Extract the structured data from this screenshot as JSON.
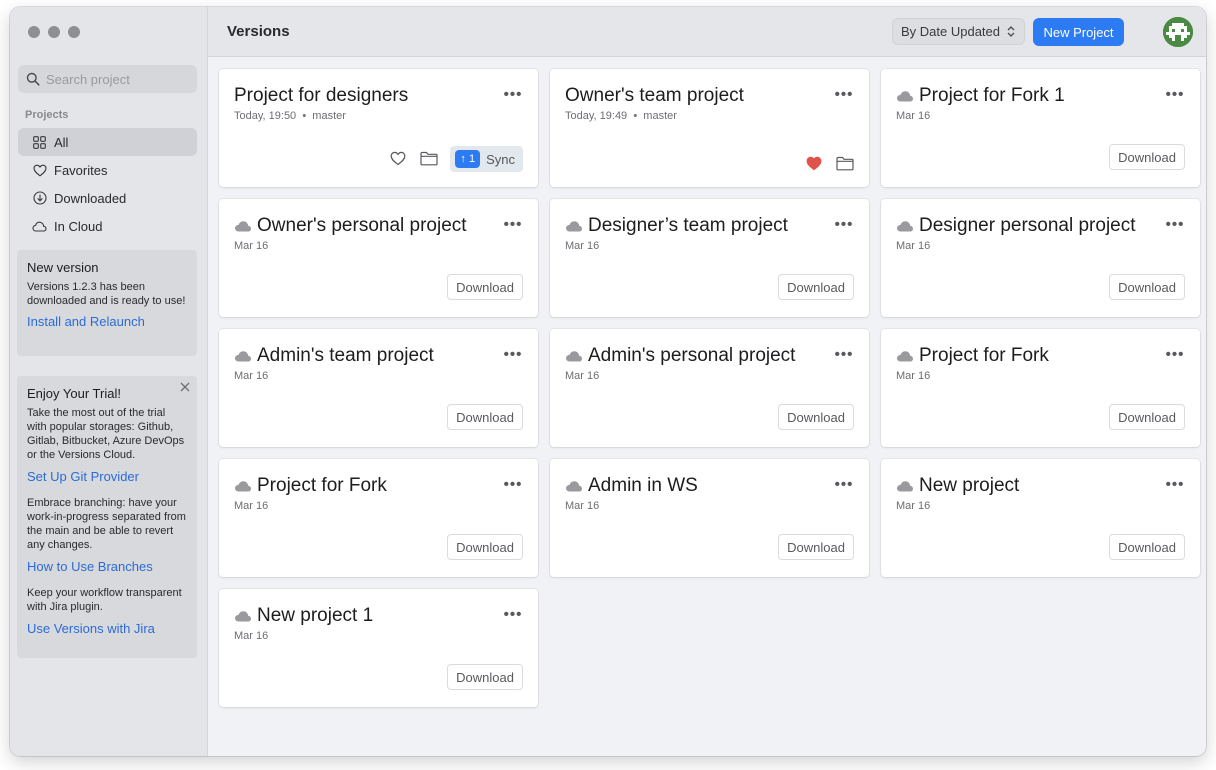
{
  "app": {
    "title": "Versions"
  },
  "sidebar": {
    "search_placeholder": "Search project",
    "section_label": "Projects",
    "items": [
      {
        "label": "All",
        "icon": "grid-icon",
        "active": true
      },
      {
        "label": "Favorites",
        "icon": "heart-icon"
      },
      {
        "label": "Downloaded",
        "icon": "download-circle-icon"
      },
      {
        "label": "In Cloud",
        "icon": "cloud-icon"
      }
    ],
    "update": {
      "title": "New version",
      "text": "Versions 1.2.3 has been downloaded and is ready to use!",
      "link": "Install and Relaunch"
    },
    "trial": {
      "title": "Enjoy Your Trial!",
      "tips": [
        {
          "text": "Take the most out of the trial with popular storages: Github, Gitlab, Bitbucket, Azure DevOps or the Versions Cloud.",
          "link": "Set Up Git Provider"
        },
        {
          "text": "Embrace branching: have your work-in-progress separated from the main and be able to revert any changes.",
          "link": "How to Use Branches"
        },
        {
          "text": "Keep your workflow transparent with Jira plugin.",
          "link": "Use Versions with Jira"
        }
      ]
    }
  },
  "toolbar": {
    "sort_label": "By Date Updated",
    "new_project_label": "New Project"
  },
  "projects": [
    {
      "name": "Project for designers",
      "date": "Today, 19:50",
      "separator": "•",
      "branch": "master",
      "local": true,
      "favorite": false,
      "sync_count": "↑ 1",
      "sync_label": "Sync"
    },
    {
      "name": "Owner's team project",
      "date": "Today, 19:49",
      "separator": "•",
      "branch": "master",
      "local": true,
      "favorite": true
    },
    {
      "name": "Project for Fork 1",
      "date": "Mar 16",
      "download_label": "Download"
    },
    {
      "name": "Owner's personal project",
      "date": "Mar 16",
      "download_label": "Download"
    },
    {
      "name": "Designer’s team project",
      "date": "Mar 16",
      "download_label": "Download"
    },
    {
      "name": "Designer personal project",
      "date": "Mar 16",
      "download_label": "Download"
    },
    {
      "name": "Admin's team project",
      "date": "Mar 16",
      "download_label": "Download"
    },
    {
      "name": "Admin's personal project",
      "date": "Mar 16",
      "download_label": "Download"
    },
    {
      "name": "Project for Fork",
      "date": "Mar 16",
      "download_label": "Download"
    },
    {
      "name": "Project for Fork",
      "date": "Mar 16",
      "download_label": "Download"
    },
    {
      "name": "Admin in WS",
      "date": "Mar 16",
      "download_label": "Download"
    },
    {
      "name": "New project",
      "date": "Mar 16",
      "download_label": "Download"
    },
    {
      "name": "New project 1",
      "date": "Mar 16",
      "download_label": "Download"
    }
  ],
  "colors": {
    "accent": "#2d7bf3",
    "favorite": "#e0524a",
    "cloud": "#9a9a9e"
  }
}
